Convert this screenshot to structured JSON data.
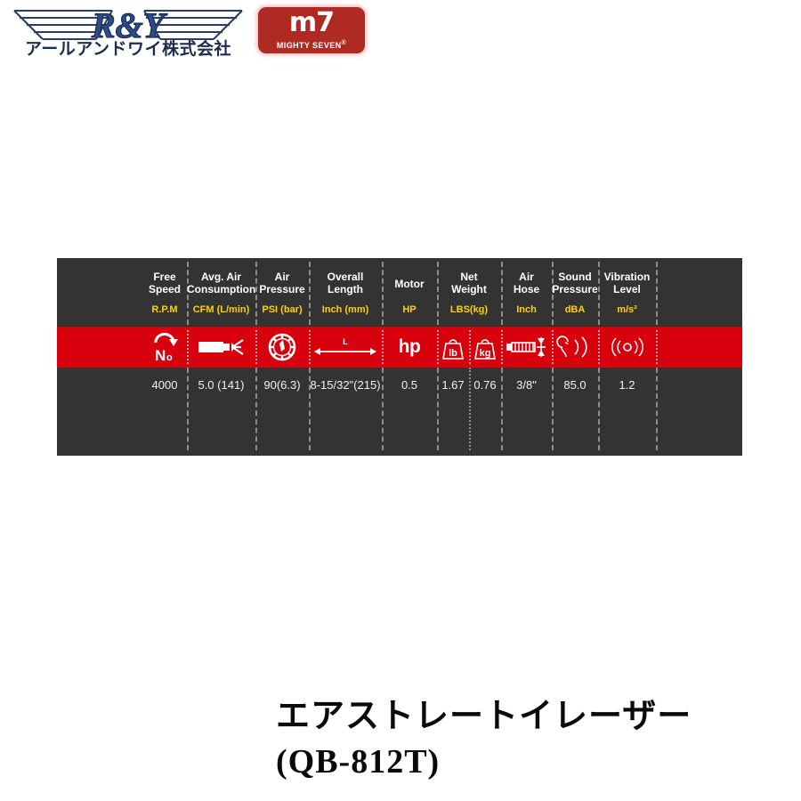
{
  "header": {
    "ry_logo": {
      "brand": "R&Y",
      "subtitle": "アールアンドワイ株式会社",
      "icon": "wings-logo"
    },
    "m7_logo": {
      "mark": "m7",
      "subtitle": "MIGHTY SEVEN",
      "registered": "®",
      "icon": "m7-brand-logo",
      "color": "#b02a24"
    }
  },
  "spec_table": {
    "colors": {
      "panel": "#333333",
      "accent_red": "#d9000d",
      "unit_yellow": "#ffd100",
      "text": "#ffffff"
    },
    "columns": [
      {
        "name": "Free\nSpeed",
        "name_l1": "Free",
        "name_l2": "Speed",
        "unit": "R.P.M",
        "icon": "no-load-speed-icon",
        "value": "4000"
      },
      {
        "name_l1": "Avg. Air",
        "name_l2": "Consumption",
        "unit": "CFM (L/min)",
        "icon": "air-consumption-icon",
        "value": "5.0 (141)"
      },
      {
        "name_l1": "Air",
        "name_l2": "Pressure",
        "unit": "PSI (bar)",
        "icon": "air-pressure-gauge-icon",
        "value": "90(6.3)"
      },
      {
        "name_l1": "Overall",
        "name_l2": "Length",
        "unit": "Inch (mm)",
        "icon": "overall-length-icon",
        "value": "8-15/32\"(215)"
      },
      {
        "name_l1": "Motor",
        "name_l2": "",
        "unit": "HP",
        "icon": "hp-text-icon",
        "icon_text": "hp",
        "value": "0.5"
      },
      {
        "name_l1": "Net",
        "name_l2": "Weight",
        "unit": "LBS(kg)",
        "icon": "weight-lb-icon",
        "icon2": "weight-kg-icon",
        "value": "1.67",
        "value2": "0.76"
      },
      {
        "name_l1": "Air",
        "name_l2": "Hose",
        "unit": "Inch",
        "icon": "air-hose-icon",
        "value": "3/8\""
      },
      {
        "name_l1": "Sound",
        "name_l2": "Pressure",
        "unit": "dBA",
        "icon": "sound-pressure-ear-icon",
        "value": "85.0"
      },
      {
        "name_l1": "Vibration",
        "name_l2": "Level",
        "unit": "m/s²",
        "icon": "vibration-level-icon",
        "value": "1.2"
      }
    ],
    "overall_length_icon_label": "L",
    "weight_lb_label": "lb",
    "weight_kg_label": "kg",
    "no_load_label": "N",
    "no_load_sub": "o"
  },
  "caption": {
    "line1": "エアストレートイレーザー",
    "line2": "(QB-812T)"
  }
}
